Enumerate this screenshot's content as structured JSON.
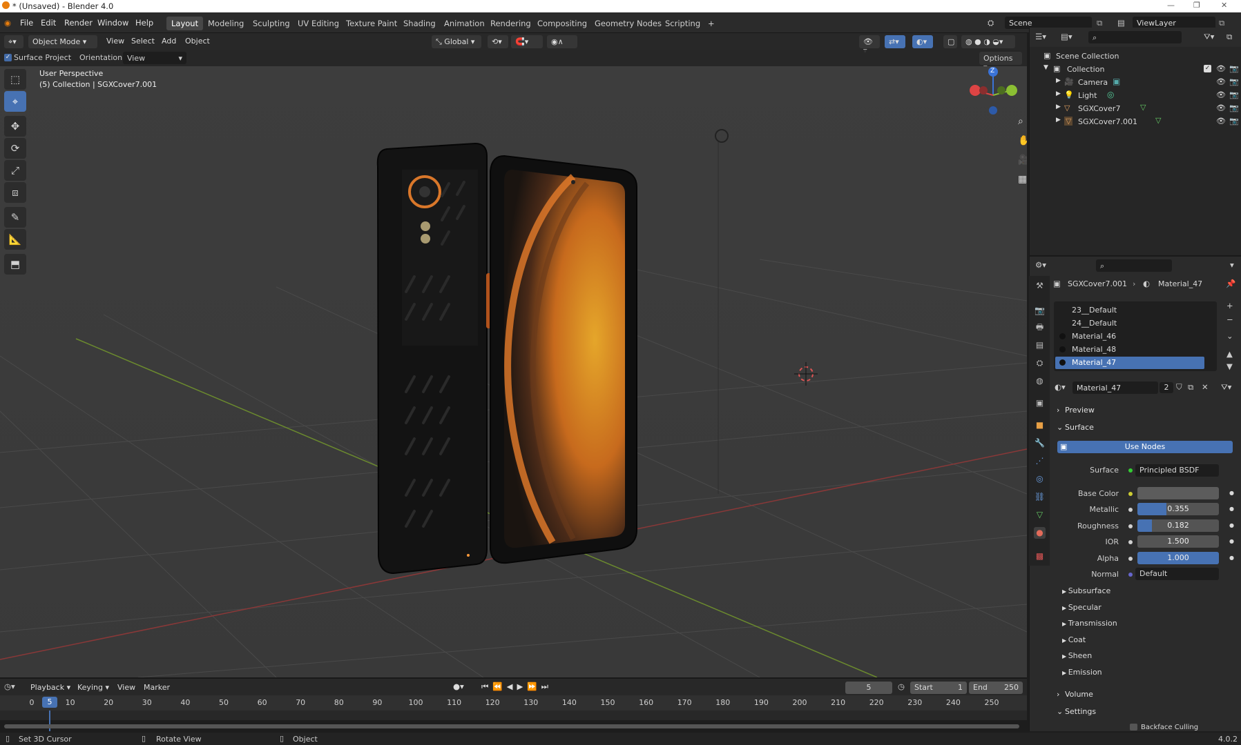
{
  "window": {
    "title": "* (Unsaved) - Blender 4.0"
  },
  "menu": [
    "File",
    "Edit",
    "Render",
    "Window",
    "Help"
  ],
  "workspaces": [
    "Layout",
    "Modeling",
    "Sculpting",
    "UV Editing",
    "Texture Paint",
    "Shading",
    "Animation",
    "Rendering",
    "Compositing",
    "Geometry Nodes",
    "Scripting"
  ],
  "active_workspace": "Layout",
  "scene": {
    "name": "Scene",
    "view_layer": "ViewLayer"
  },
  "viewport_header": {
    "mode": "Object Mode",
    "menus": [
      "View",
      "Select",
      "Add",
      "Object"
    ],
    "orientation_global": "Global",
    "options": "Options"
  },
  "tool_settings": {
    "surface_project": "Surface Project",
    "orientation_label": "Orientation:",
    "orientation_value": "View"
  },
  "viewport": {
    "perspective": "User Perspective",
    "collection_info": "(5) Collection | SGXCover7.001",
    "axis_z": "Z"
  },
  "outliner": {
    "root": "Scene Collection",
    "collection": "Collection",
    "items": [
      "Camera",
      "Light",
      "SGXCover7",
      "SGXCover7.001"
    ]
  },
  "properties": {
    "breadcrumb_object": "SGXCover7.001",
    "breadcrumb_material": "Material_47",
    "slots": [
      "23__Default",
      "24__Default",
      "Material_46",
      "Material_48",
      "Material_47"
    ],
    "material_name": "Material_47",
    "users": "2",
    "panels": {
      "preview": "Preview",
      "surface": "Surface",
      "use_nodes": "Use Nodes"
    },
    "surface_label": "Surface",
    "surface_value": "Principled BSDF",
    "base_color_label": "Base Color",
    "metallic_label": "Metallic",
    "metallic_value": "0.355",
    "metallic_fraction": 0.355,
    "roughness_label": "Roughness",
    "roughness_value": "0.182",
    "roughness_fraction": 0.182,
    "ior_label": "IOR",
    "ior_value": "1.500",
    "alpha_label": "Alpha",
    "alpha_value": "1.000",
    "alpha_fraction": 1.0,
    "normal_label": "Normal",
    "normal_value": "Default",
    "subpanels": [
      "Subsurface",
      "Specular",
      "Transmission",
      "Coat",
      "Sheen",
      "Emission"
    ],
    "volume": "Volume",
    "settings": "Settings",
    "backface": "Backface Culling"
  },
  "timeline": {
    "menus": [
      "Playback",
      "Keying",
      "View",
      "Marker"
    ],
    "current_frame": "5",
    "start_label": "Start",
    "start": "1",
    "end_label": "End",
    "end": "250",
    "ticks": [
      "0",
      "10",
      "20",
      "30",
      "40",
      "50",
      "60",
      "70",
      "80",
      "90",
      "100",
      "110",
      "120",
      "130",
      "140",
      "150",
      "160",
      "170",
      "180",
      "190",
      "200",
      "210",
      "220",
      "230",
      "240",
      "250"
    ],
    "playhead": "5"
  },
  "statusbar": {
    "left": "Set 3D Cursor",
    "mid": "Rotate View",
    "right": "Object",
    "version": "4.0.2"
  },
  "colors": {
    "accent": "#4772b3",
    "viewport_bg": "#3c3c3c",
    "phone_body": "#141414",
    "phone_orange": "#d9772a"
  }
}
